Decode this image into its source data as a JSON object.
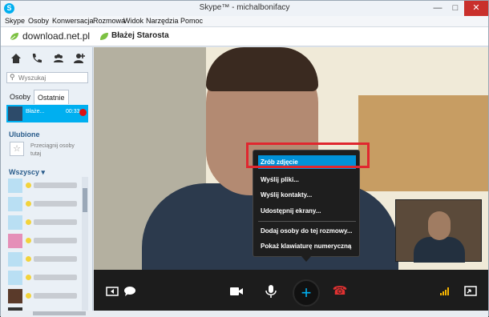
{
  "window": {
    "title": "Skype™ - michalbonifacy",
    "app_icon_letter": "S",
    "controls": {
      "minimize": "—",
      "maximize": "□",
      "close": "✕"
    }
  },
  "menubar": [
    "Skype",
    "Osoby",
    "Konwersacja",
    "Rozmowa",
    "Widok",
    "Narzędzia",
    "Pomoc"
  ],
  "header": {
    "account": "download.net.pl",
    "contact_name": "Błażej Starosta"
  },
  "sidebar": {
    "search_placeholder": "Wyszukaj",
    "tabs": [
      "Osoby",
      "Ostatnie"
    ],
    "recent_item": {
      "name": "Błaże...",
      "time": "00:33"
    },
    "favorites_title": "Ulubione",
    "favorites_hint": "Przeciągnij osoby tutaj",
    "all_title": "Wszyscy",
    "icons": [
      "home-icon",
      "phone-icon",
      "group-icon",
      "add-contact-icon"
    ]
  },
  "context_menu": {
    "items": [
      "Zrób zdjęcie",
      "Wyślij pliki...",
      "Wyślij kontakty...",
      "Udostępnij ekrany...",
      "Dodaj osoby do tej rozmowy...",
      "Pokaż klawiaturę numeryczną"
    ],
    "highlighted_index": 0
  },
  "toolbar": {
    "icons": [
      "sidebar-toggle-icon",
      "chat-icon",
      "video-icon",
      "microphone-icon",
      "add-icon",
      "hang-up-icon",
      "signal-icon",
      "fullscreen-icon"
    ],
    "add_glyph": "+",
    "hang_glyph": "☎"
  },
  "colors": {
    "accent": "#00aff0",
    "highlight": "#0091d8",
    "annotation": "#e0272f",
    "hangup": "#e03131"
  }
}
